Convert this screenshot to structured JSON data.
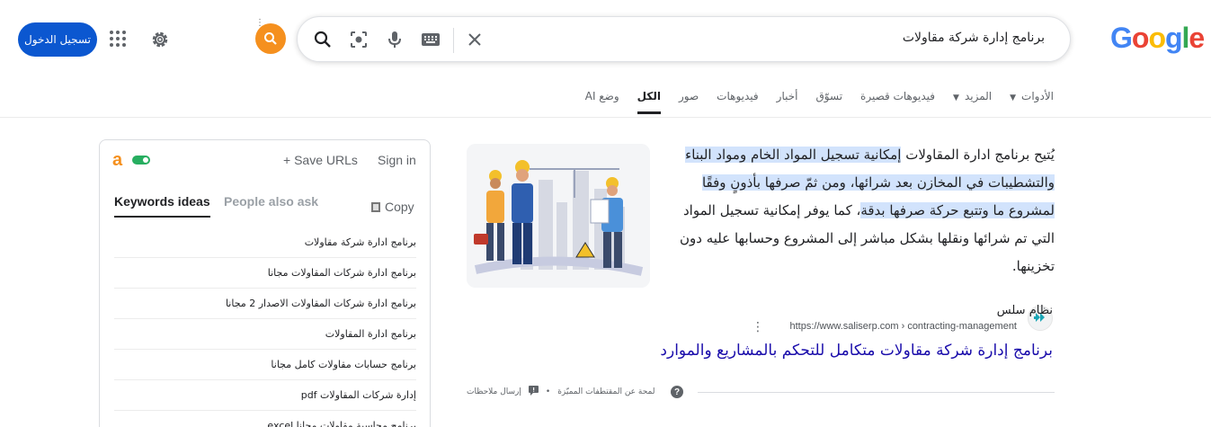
{
  "header": {
    "logo": "Google",
    "search_query": "برنامج إدارة شركة مقاولات",
    "signin_label": "تسجيل الدخول"
  },
  "tabs": [
    {
      "label": "وضع AI",
      "active": false
    },
    {
      "label": "الكل",
      "active": true
    },
    {
      "label": "صور",
      "active": false
    },
    {
      "label": "فيديوهات",
      "active": false
    },
    {
      "label": "أخبار",
      "active": false
    },
    {
      "label": "تسوّق",
      "active": false
    },
    {
      "label": "فيديوهات قصيرة",
      "active": false
    },
    {
      "label": "المزيد",
      "active": false
    },
    {
      "label": "الأدوات",
      "active": false
    }
  ],
  "panel": {
    "brand_letter": "a",
    "save_urls": "Save URLs",
    "sign_in": "Sign in",
    "tab_keywords": "Keywords ideas",
    "tab_paa": "People also ask",
    "copy": "Copy",
    "keywords": [
      "برنامج ادارة شركة مقاولات",
      "برنامج ادارة شركات المقاولات مجانا",
      "برنامج ادارة شركات المقاولات الاصدار 2 مجانا",
      "برنامج ادارة المقاولات",
      "برنامج حسابات مقاولات كامل مجانا",
      "إدارة شركات المقاولات pdf",
      "برنامج محاسبة مقاولات مجانا excel"
    ]
  },
  "snippet": {
    "text_plain_1": "يُتيح برنامج ادارة المقاولات ",
    "text_highlight": "إمكانية تسجيل المواد الخام ومواد البناء والتشطيبات في المخازن بعد شرائها، ومن ثمّ صرفها بأذونٍ وفقًا لمشروع ما وتتبع حركة صرفها بدقة",
    "text_plain_2": "، كما يوفر إمكانية تسجيل المواد التي تم شرائها ونقلها بشكل مباشر إلى المشروع وحسابها عليه دون تخزينها.",
    "site_name": "نظام سلس",
    "site_url": "https://www.saliserp.com › contracting-management",
    "result_title": "برنامج إدارة شركة مقاولات متكامل للتحكم بالمشاريع والموارد",
    "feedback_about": "لمحة عن المقتطفات المميّزة",
    "feedback_send": "إرسال ملاحظات",
    "feedback_sep": "•"
  },
  "colors": {
    "signin_bg": "#0b57d0",
    "orange": "#f5901e",
    "link": "#1a0dab",
    "highlight": "#d2e3fc"
  }
}
